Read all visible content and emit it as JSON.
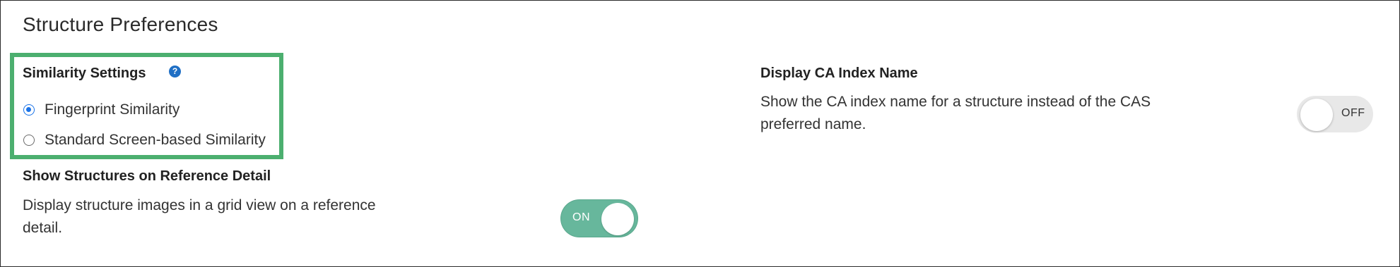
{
  "page": {
    "title": "Structure Preferences"
  },
  "similarity": {
    "heading": "Similarity Settings",
    "help_icon": "?",
    "options": [
      {
        "label": "Fingerprint Similarity",
        "selected": true
      },
      {
        "label": "Standard Screen-based Similarity",
        "selected": false
      }
    ],
    "highlight_color": "#4caf6f"
  },
  "show_structures": {
    "heading": "Show Structures on Reference Detail",
    "description_line1": "Display structure images in a grid view on a reference",
    "description_line2": "detail.",
    "toggle_state": "ON",
    "toggle_color": "#67b79c"
  },
  "ca_index": {
    "heading": "Display CA Index Name",
    "description_line1": "Show the CA index name for a structure instead of the CAS",
    "description_line2": "preferred name.",
    "toggle_state": "OFF",
    "toggle_color": "#e8e8e8"
  },
  "icons": {
    "help": "help-icon",
    "radio_checked": "radio-checked-icon",
    "radio_unchecked": "radio-unchecked-icon"
  },
  "colors": {
    "accent_blue": "#1a73e8",
    "help_blue": "#1f6fc5"
  }
}
